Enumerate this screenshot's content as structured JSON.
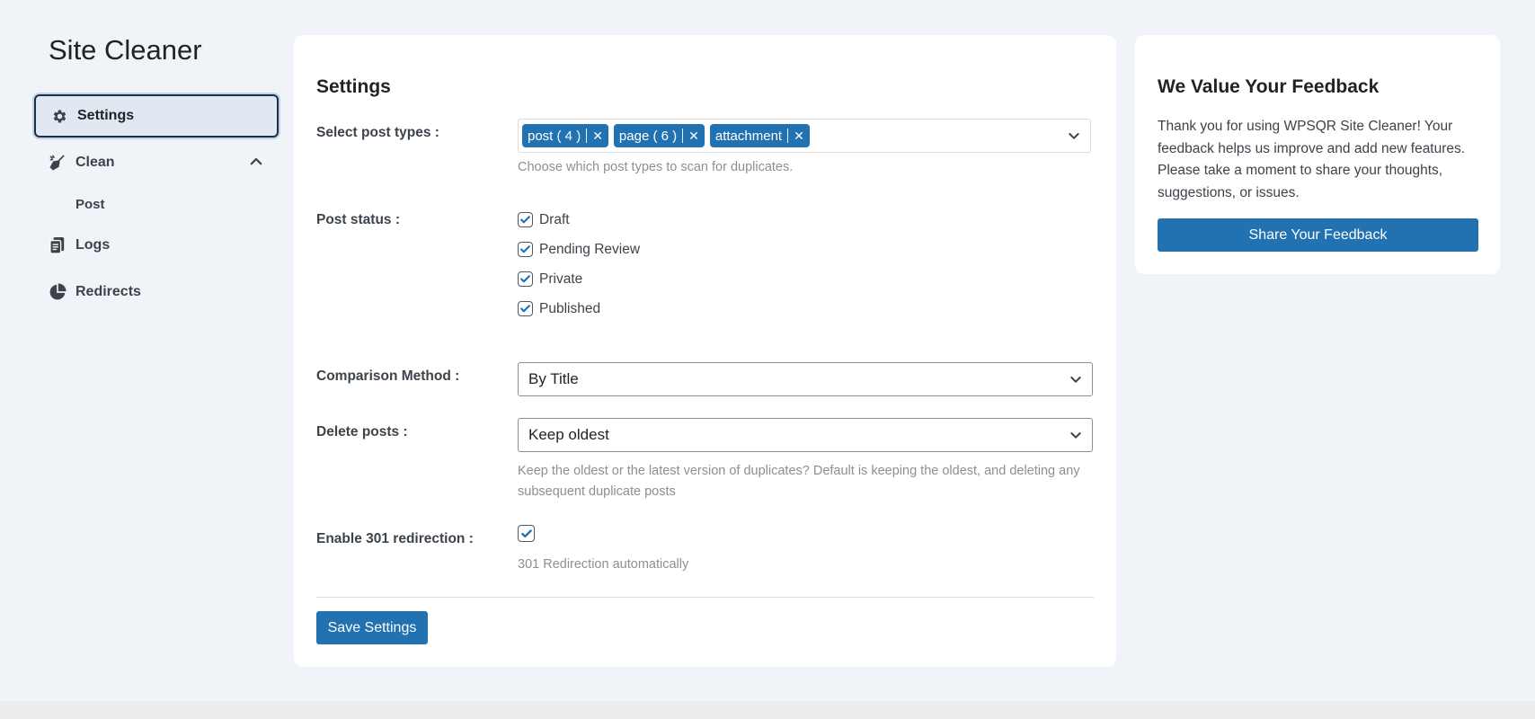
{
  "app": {
    "title": "Site Cleaner"
  },
  "sidebar": {
    "items": [
      {
        "label": "Settings",
        "icon": "gear-icon",
        "active": true
      },
      {
        "label": "Clean",
        "icon": "broom-icon",
        "expanded": true,
        "children": [
          {
            "label": "Post"
          }
        ]
      },
      {
        "label": "Logs",
        "icon": "logs-icon"
      },
      {
        "label": "Redirects",
        "icon": "pie-chart-icon"
      }
    ]
  },
  "settings": {
    "title": "Settings",
    "post_types": {
      "label": "Select post types :",
      "tags": [
        "post ( 4 )",
        "page ( 6 )",
        "attachment"
      ],
      "hint": "Choose which post types to scan for duplicates."
    },
    "post_status": {
      "label": "Post status :",
      "options": [
        {
          "label": "Draft",
          "checked": true
        },
        {
          "label": "Pending Review",
          "checked": true
        },
        {
          "label": "Private",
          "checked": true
        },
        {
          "label": "Published",
          "checked": true
        }
      ]
    },
    "comparison": {
      "label": "Comparison Method :",
      "value": "By Title"
    },
    "delete": {
      "label": "Delete posts :",
      "value": "Keep oldest",
      "hint": "Keep the oldest or the latest version of duplicates? Default is keeping the oldest, and deleting any subsequent duplicate posts"
    },
    "redirection": {
      "label": "Enable 301 redirection :",
      "checked": true,
      "hint": "301 Redirection automatically"
    },
    "save_label": "Save Settings"
  },
  "feedback": {
    "title": "We Value Your Feedback",
    "text": "Thank you for using WPSQR Site Cleaner! Your feedback helps us improve and add new features. Please take a moment to share your thoughts, suggestions, or issues.",
    "button_label": "Share Your Feedback"
  },
  "colors": {
    "accent": "#2271b1",
    "background": "#f0f3f7",
    "active_nav": "#e0e8f1"
  }
}
